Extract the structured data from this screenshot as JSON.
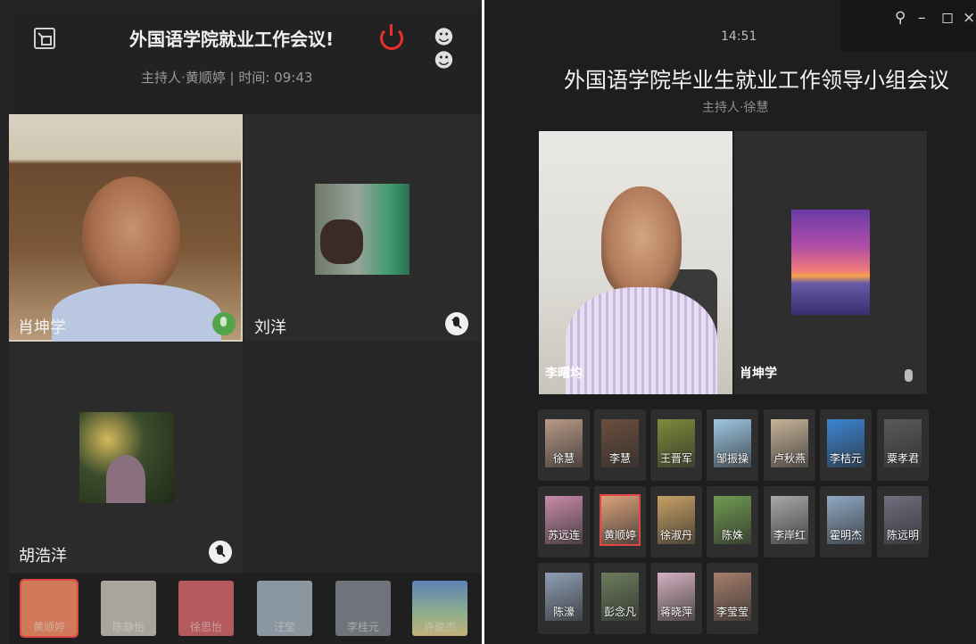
{
  "left": {
    "title": "外国语学院就业工作会议!",
    "subtitle": "主持人·黄顺婷 | 时间: 09:43",
    "participants": [
      {
        "name": "肖坤学",
        "mic": "speaking-icon"
      },
      {
        "name": "刘洋",
        "mic": "mic-muted-icon"
      },
      {
        "name": "胡浩洋",
        "mic": "mic-muted-icon"
      }
    ],
    "strip": [
      "黄顺婷",
      "陈静怡",
      "徐思怡",
      "汪莹",
      "李桂元",
      "许俊杰"
    ]
  },
  "right": {
    "time": "14:51",
    "title": "外国语学院毕业生就业工作领导小组会议",
    "subtitle": "主持人·徐慧",
    "main_videos": [
      {
        "name": "李曙均"
      },
      {
        "name": "肖坤学"
      }
    ],
    "window_controls": {
      "pin": "pin-icon",
      "minimize": "minimize-icon",
      "maximize": "maximize-icon",
      "close": "close-icon"
    },
    "attendees": [
      {
        "name": "徐慧",
        "color": "#b99a86"
      },
      {
        "name": "李慧",
        "color": "#6b4e3e"
      },
      {
        "name": "王晋军",
        "color": "#7f8b3a"
      },
      {
        "name": "邹振操",
        "color": "#9ec7e4"
      },
      {
        "name": "卢秋燕",
        "color": "#c7b49a"
      },
      {
        "name": "李桔元",
        "color": "#3c86d4"
      },
      {
        "name": "粟孝君",
        "color": "#5a5a5a"
      },
      {
        "name": "苏远连",
        "color": "#c88aa8"
      },
      {
        "name": "黄顺婷",
        "color": "#d9a27a"
      },
      {
        "name": "徐淑丹",
        "color": "#c7a064"
      },
      {
        "name": "陈姝",
        "color": "#6f9a4f"
      },
      {
        "name": "李岸红",
        "color": "#a8a8a8"
      },
      {
        "name": "霍明杰",
        "color": "#8fa8c4"
      },
      {
        "name": "陈远明",
        "color": "#6f6f7f"
      },
      {
        "name": "陈濠",
        "color": "#8f9fb4"
      },
      {
        "name": "彭念凡",
        "color": "#6c7c5c"
      },
      {
        "name": "蒋晓萍",
        "color": "#d5b1c1"
      },
      {
        "name": "李莹莹",
        "color": "#a57d6c"
      }
    ]
  }
}
